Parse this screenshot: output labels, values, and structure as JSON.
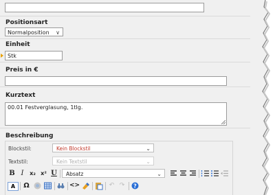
{
  "form": {
    "top_field_value": "",
    "positionsart": {
      "label": "Positionsart",
      "value": "Normalposition"
    },
    "einheit": {
      "label": "Einheit",
      "value": "Stk"
    },
    "preis": {
      "label": "Preis in €",
      "value": ""
    },
    "kurztext": {
      "label": "Kurztext",
      "value": "00.01 Festverglasung, 1tlg."
    },
    "beschreibung": {
      "label": "Beschreibung",
      "blockstil": {
        "label": "Blockstil:",
        "value": "Kein Blockstil"
      },
      "textstil": {
        "label": "Textstil:",
        "value": "Kein Textstil"
      },
      "format": {
        "value": "Absatz"
      },
      "buttons": {
        "bold": "B",
        "italic": "I",
        "subscript": "x₂",
        "superscript": "x²",
        "underline": "U",
        "textcolor": "A",
        "special_chars": "Ω"
      }
    }
  },
  "icons": [
    "dropdown-caret-icon",
    "bold-icon",
    "italic-icon",
    "subscript-icon",
    "superscript-icon",
    "underline-icon",
    "align-left-icon",
    "align-center-icon",
    "align-right-icon",
    "ordered-list-icon",
    "unordered-list-icon",
    "outdent-icon",
    "indent-icon",
    "text-color-icon",
    "special-chars-icon",
    "emoticon-icon",
    "table-icon",
    "find-icon",
    "source-code-icon",
    "clean-format-icon",
    "paste-word-icon",
    "undo-icon",
    "redo-icon",
    "help-icon"
  ],
  "colors": {
    "panel": "#f0f0f0",
    "marker": "#e8a000",
    "help": "#2a6fd6"
  }
}
